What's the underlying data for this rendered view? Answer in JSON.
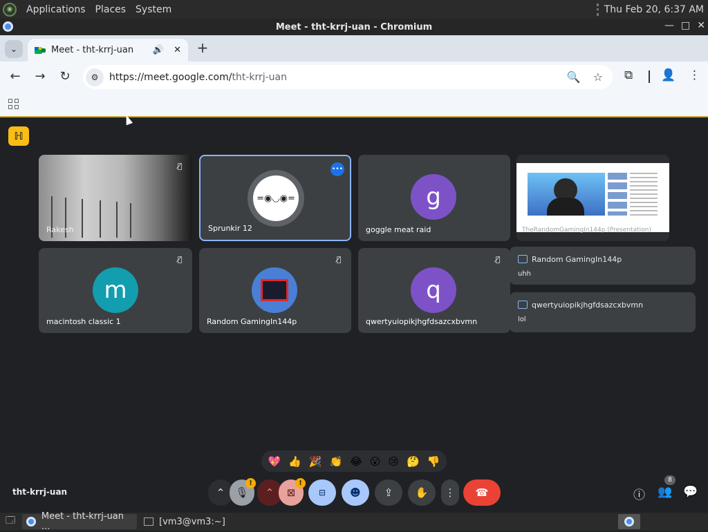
{
  "system_panel": {
    "menu": [
      "Applications",
      "Places",
      "System"
    ],
    "clock": "Thu Feb 20,  6:37 AM"
  },
  "window": {
    "title": "Meet - tht-krrj-uan - Chromium"
  },
  "browser": {
    "tab_title": "Meet - tht-krrj-uan",
    "url_host": "https://meet.google.com/",
    "url_path": "tht-krrj-uan"
  },
  "meet": {
    "badge": "ℍ",
    "tiles": [
      {
        "name": "Rakesh"
      },
      {
        "name": "Sprunkir 12"
      },
      {
        "name": "goggle meat raid",
        "initial": "g",
        "color": "#7d52c7"
      },
      {
        "name": "macintosh classic 1",
        "initial": "m",
        "color": "#129eaf"
      },
      {
        "name": "Random GamingIn144p"
      },
      {
        "name": "qwertyuiopikjhgfdsazcxbvmn",
        "initial": "q",
        "color": "#7d52c7"
      }
    ],
    "presentation_caption": "TheRandomGamingIn144p (Presentation)",
    "chat": [
      {
        "sender": "Random GamingIn144p",
        "message": "uhh"
      },
      {
        "sender": "qwertyuiopikjhgfdsazcxbvmn",
        "message": "lol"
      }
    ],
    "reactions": [
      "💖",
      "👍",
      "🎉",
      "👏",
      "😂",
      "😮",
      "😢",
      "🤔",
      "👎"
    ],
    "meeting_code": "tht-krrj-uan",
    "warning_mark": "!",
    "people_count": "8"
  },
  "taskbar": {
    "items": [
      "Meet - tht-krrj-uan ...",
      "[vm3@vm3:~]"
    ]
  }
}
